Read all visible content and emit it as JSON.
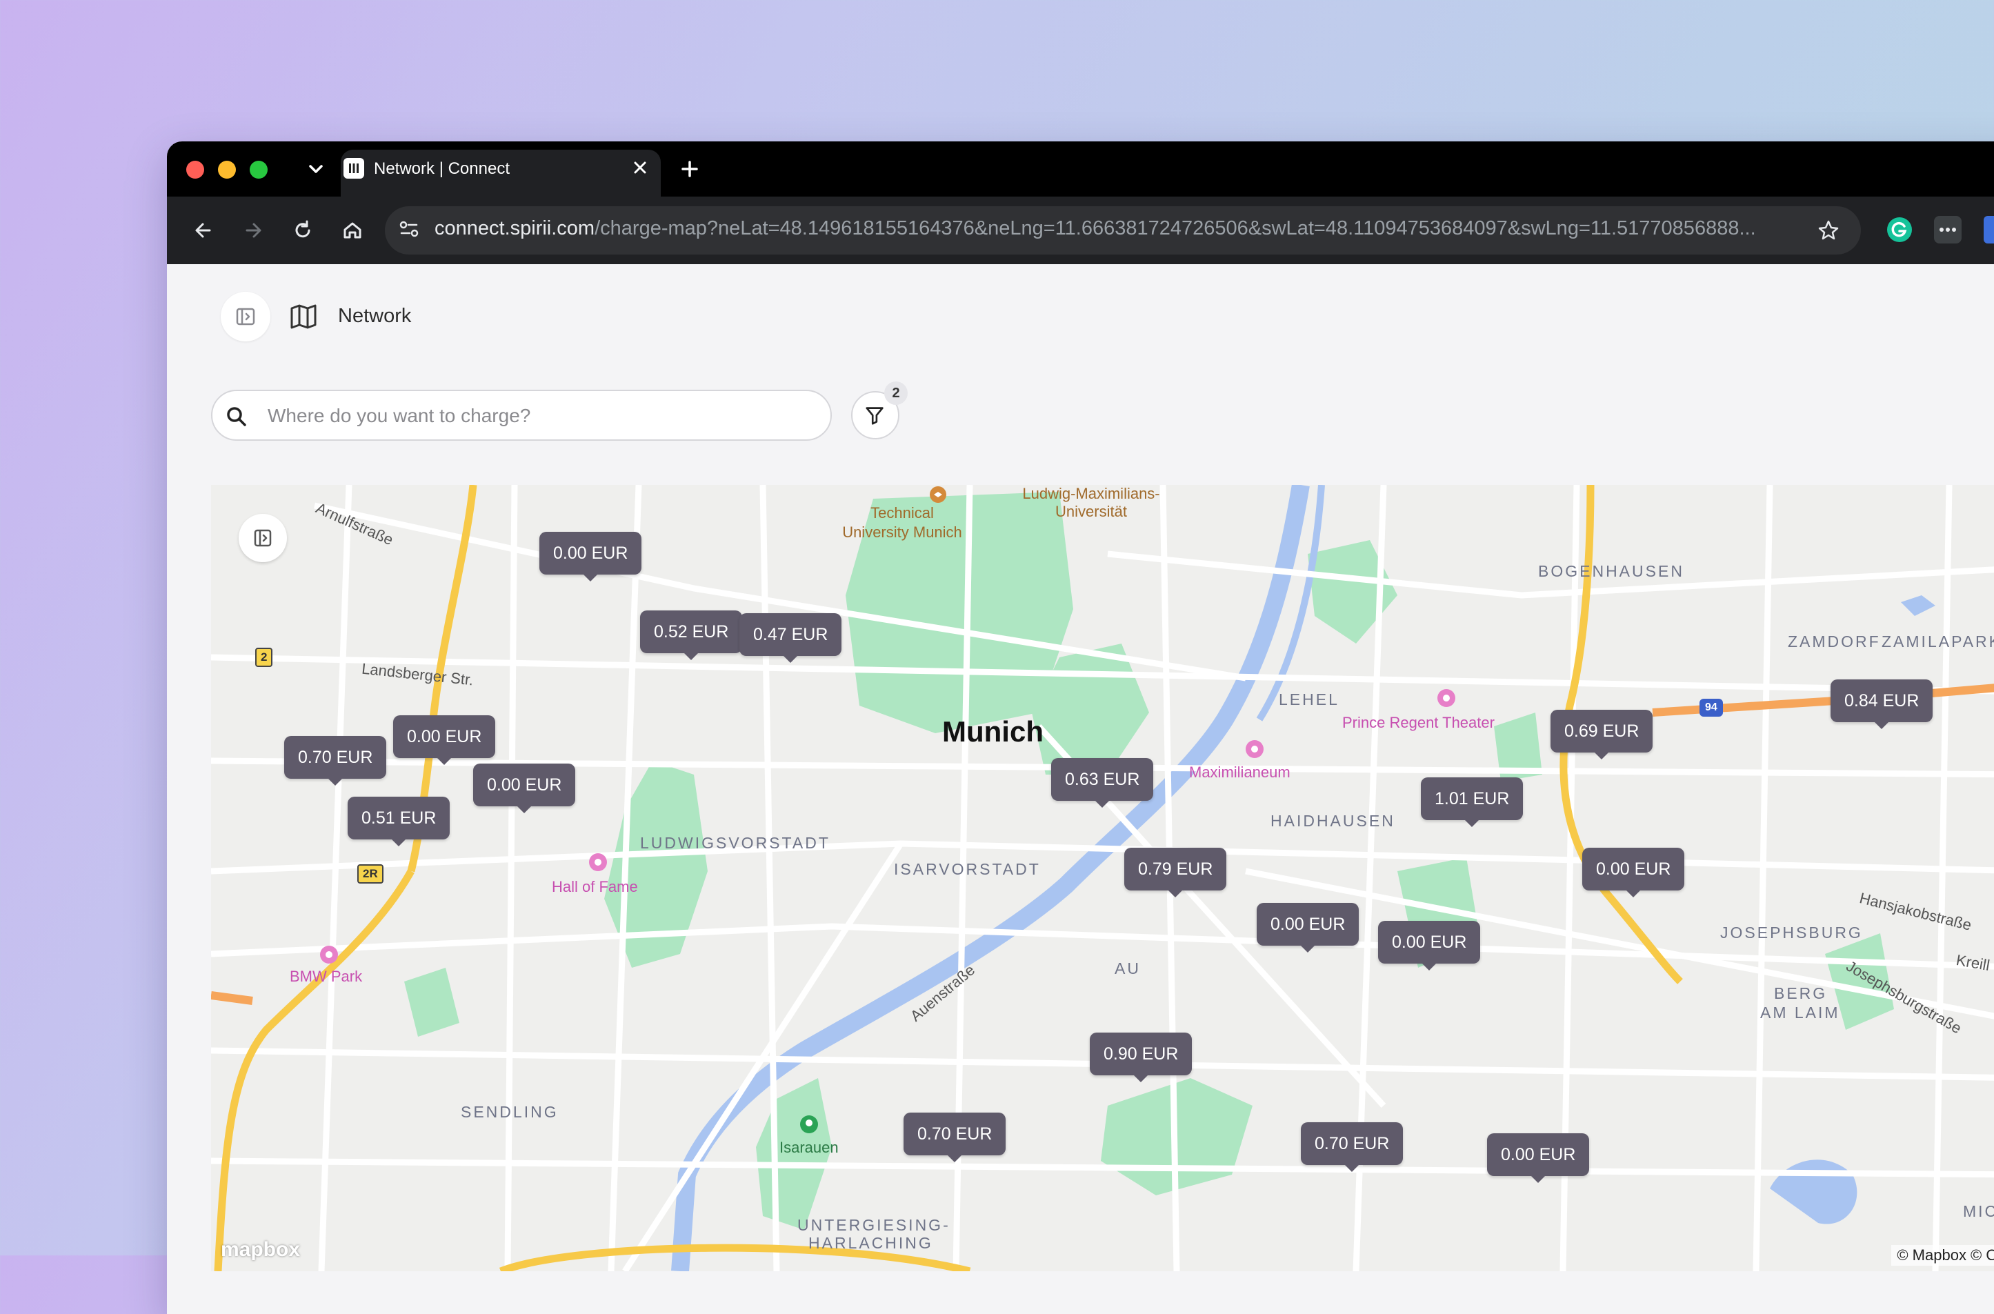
{
  "browser": {
    "tab_title": "Network | Connect",
    "url_host": "connect.spirii.com",
    "url_path": "/charge-map?neLat=48.149618155164376&neLng=11.666381724726506&swLat=48.11094753684097&swLng=11.51770856888..."
  },
  "header": {
    "title": "Network"
  },
  "search": {
    "placeholder": "Where do you want to charge?"
  },
  "filter": {
    "badge_count": "2"
  },
  "map": {
    "city_label": "Munich",
    "districts": {
      "bogenhausen": "BOGENHAUSEN",
      "zamdorf": "ZAMDORF",
      "zamilapark": "ZAMILAPARK",
      "lehel": "LEHEL",
      "haidhausen": "HAIDHAUSEN",
      "ludwigsvorstadt": "LUDWIGSVORSTADT",
      "isarvorstadt": "ISARVORSTADT",
      "au": "AU",
      "josephsburg": "JOSEPHSBURG",
      "berg": "BERG",
      "am_laim": "AM LAIM",
      "sendling": "SENDLING",
      "untergiesing": "UNTERGIESING-",
      "harlaching": "HARLACHING",
      "michael": "MICHAEL"
    },
    "streets": {
      "arnulf": "Arnulfstraße",
      "landsberger": "Landsberger Str.",
      "auen": "Auenstraße",
      "hansjakob": "Hansjakobstraße",
      "josephsburg": "Josephsburgstraße",
      "kreil": "Kreill"
    },
    "pois": {
      "tum_1": "Technical",
      "tum_2": "University Munich",
      "lmu_1": "Ludwig-Maximilians-",
      "lmu_2": "Universität",
      "prince_regent": "Prince Regent Theater",
      "maximilianeum": "Maximilianeum",
      "hall_of_fame": "Hall of Fame",
      "bmw_park": "BMW Park",
      "isarauen": "Isarauen"
    },
    "road_shields": {
      "a2": "2",
      "a2r": "2R",
      "a94": "94"
    },
    "prices": [
      "0.00 EUR",
      "0.52 EUR",
      "0.47 EUR",
      "0.00 EUR",
      "0.70 EUR",
      "0.00 EUR",
      "0.51 EUR",
      "0.63 EUR",
      "0.79 EUR",
      "0.00 EUR",
      "0.00 EUR",
      "1.01 EUR",
      "0.69 EUR",
      "0.84 EUR",
      "0.00 EUR",
      "0.90 EUR",
      "0.70 EUR",
      "0.70 EUR",
      "0.00 EUR"
    ],
    "logo_text": "mapbox",
    "attribution": "© Mapbox © OpenSt"
  },
  "colors": {
    "marker_bg": "#5f5a6a",
    "park": "#aee6c2",
    "water": "#a9c4f1",
    "highway": "#f7c948",
    "motorway": "#f6a55a"
  }
}
